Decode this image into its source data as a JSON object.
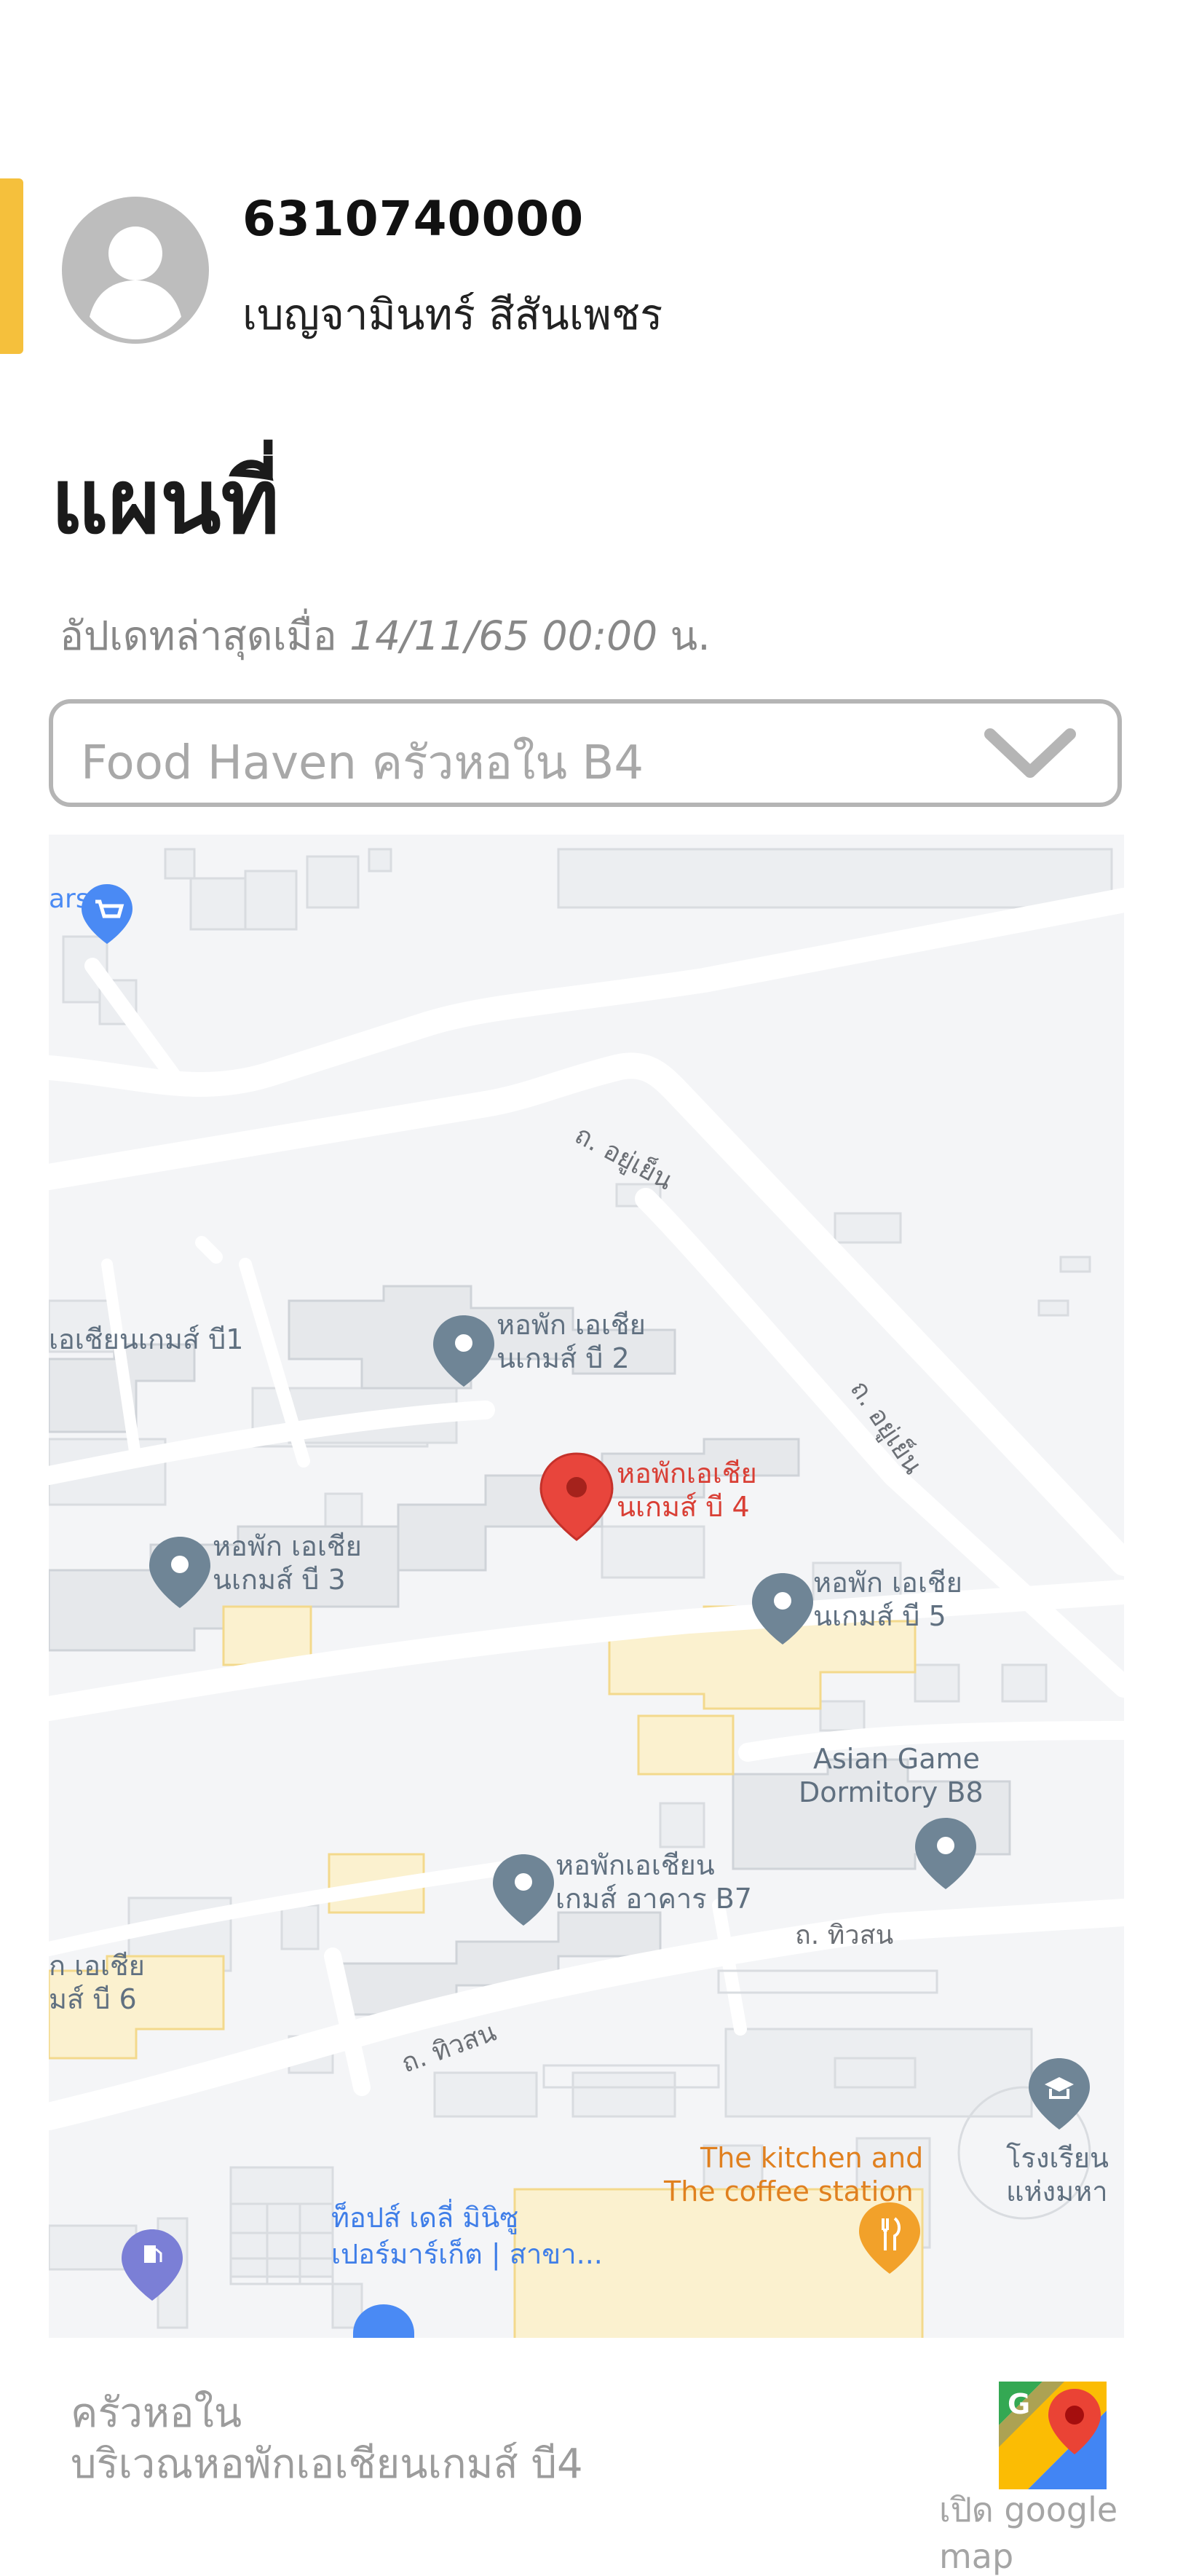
{
  "profile": {
    "student_id": "6310740000",
    "name": "เบญจามินทร์ สีสันเพชร"
  },
  "page": {
    "title": "แผนที่",
    "updated_label": "อัปเดทล่าสุดเมื่อ",
    "updated_time": "14/11/65 00:00",
    "updated_suffix": "น."
  },
  "location_select": {
    "selected": "Food Haven ครัวหอใน B4"
  },
  "map": {
    "roads": {
      "yuyen_1": "ถ. อยู่เย็น",
      "yuyen_2": "ถ. อยู่เย็น",
      "thiwason_1": "ถ. ทิวสน",
      "thiwason_2": "ถ. ทิวสน"
    },
    "places": {
      "shop_cut": "ars",
      "dorm_b1": "เอเชียนเกมส์ บี1",
      "dorm_b2_l1": "หอพัก เอเชีย",
      "dorm_b2_l2": "นเกมส์ บี 2",
      "dorm_b4_l1": "หอพักเอเชีย",
      "dorm_b4_l2": "นเกมส์ บี 4",
      "dorm_b3_l1": "หอพัก เอเชีย",
      "dorm_b3_l2": "นเกมส์ บี 3",
      "dorm_b5_l1": "หอพัก เอเชีย",
      "dorm_b5_l2": "นเกมส์ บี 5",
      "b8_l1": "Asian Game",
      "b8_l2": "Dormitory B8",
      "b7_l1": "หอพักเอเชียน",
      "b7_l2": "เกมส์ อาคาร B7",
      "b6_l1": "ัก เอเชีย",
      "b6_l2": "มส์ บี 6",
      "kitchen_l1": "The kitchen and",
      "kitchen_l2": "The coffee station",
      "school_l1": "โรงเรียน",
      "school_l2": "แห่งมหา",
      "tops_l1": "ท็อปส์ เดลี่ มินิซู",
      "tops_l2": "เปอร์มาร์เก็ต | สาขา..."
    },
    "colors": {
      "selected_pin": "#e8453c",
      "dorm_pin": "#6f8596",
      "kitchen_pin": "#f2a12a",
      "shop_pin": "#4a8af4",
      "gas_pin": "#7b7fd6",
      "kitchen_text": "#e0801f",
      "tops_text": "#3f7ee8"
    }
  },
  "footer": {
    "place_line1": "ครัวหอใน",
    "place_line2": "บริเวณหอพักเอเชียนเกมส์ บี4",
    "open_gmaps": "เปิด google map"
  }
}
